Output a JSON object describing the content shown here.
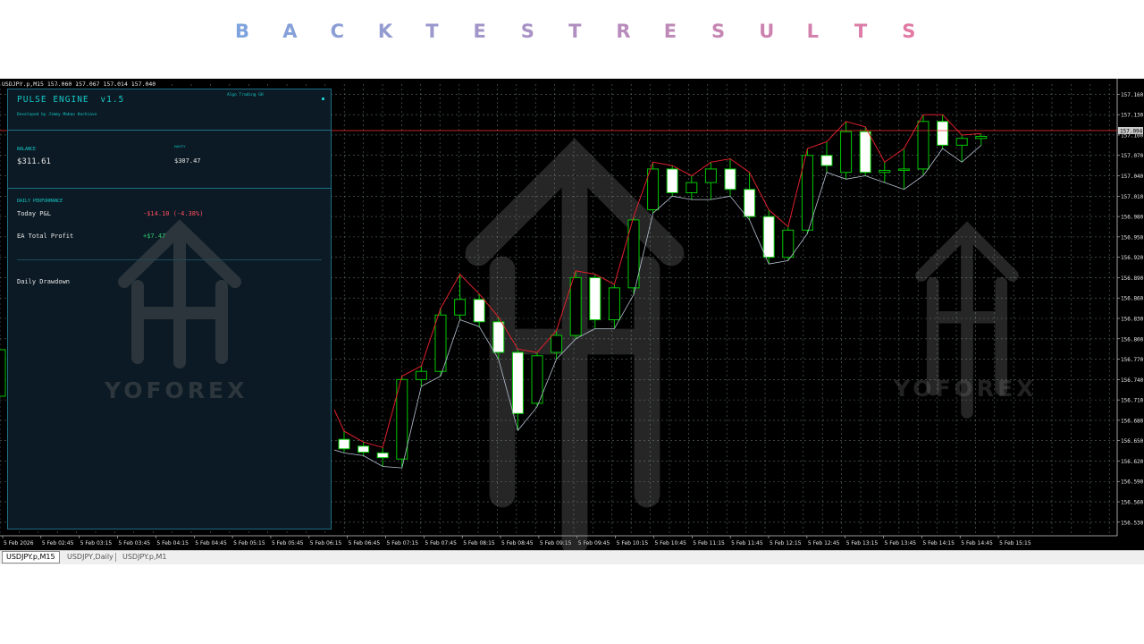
{
  "header": {
    "title": "BACKTEST RESULTS",
    "title_gradient": [
      "#7fa4dd",
      "#e27aa4"
    ]
  },
  "chart": {
    "symbol_info": "USDJPY.p,M15  157.060 157.067 157.014 157.040",
    "bid_price_label": "157.094",
    "watermark_text": "YOFOREX",
    "colors": {
      "background": "#000000",
      "grid": "#5c6b6b",
      "bull_body": "#000000",
      "bear_body": "#ffffff",
      "candle_outline": "#00c800",
      "upper_line": "#e0202c",
      "lower_line": "#b7c3d4",
      "bid_line": "#ff3030"
    }
  },
  "chart_data": {
    "type": "candlestick",
    "symbol": "USDJPY.p",
    "timeframe": "M15",
    "y_ticks": [
      "157.160",
      "157.130",
      "157.100",
      "157.070",
      "157.040",
      "157.010",
      "156.980",
      "156.950",
      "156.920",
      "156.890",
      "156.860",
      "156.830",
      "156.800",
      "156.770",
      "156.740",
      "156.710",
      "156.680",
      "156.650",
      "156.620",
      "156.590",
      "156.560",
      "156.530"
    ],
    "ylim": [
      156.51,
      157.175
    ],
    "x_ticks": [
      "5 Feb 2026",
      "5 Feb 02:45",
      "5 Feb 03:15",
      "5 Feb 03:45",
      "5 Feb 04:15",
      "5 Feb 04:45",
      "5 Feb 05:15",
      "5 Feb 05:45",
      "5 Feb 06:15",
      "5 Feb 06:45",
      "5 Feb 07:15",
      "5 Feb 07:45",
      "5 Feb 08:15",
      "5 Feb 08:45",
      "5 Feb 09:15",
      "5 Feb 09:45",
      "5 Feb 10:15",
      "5 Feb 10:45",
      "5 Feb 11:15",
      "5 Feb 11:45",
      "5 Feb 12:15",
      "5 Feb 12:45",
      "5 Feb 13:15",
      "5 Feb 13:45",
      "5 Feb 14:15",
      "5 Feb 14:45",
      "5 Feb 15:15"
    ],
    "candles": [
      {
        "o": 156.652,
        "h": 156.664,
        "l": 156.632,
        "c": 156.638
      },
      {
        "o": 156.642,
        "h": 156.648,
        "l": 156.628,
        "c": 156.633
      },
      {
        "o": 156.632,
        "h": 156.64,
        "l": 156.612,
        "c": 156.625
      },
      {
        "o": 156.623,
        "h": 156.745,
        "l": 156.61,
        "c": 156.74
      },
      {
        "o": 156.74,
        "h": 156.76,
        "l": 156.73,
        "c": 156.752
      },
      {
        "o": 156.752,
        "h": 156.845,
        "l": 156.745,
        "c": 156.835
      },
      {
        "o": 156.835,
        "h": 156.895,
        "l": 156.828,
        "c": 156.858
      },
      {
        "o": 156.858,
        "h": 156.866,
        "l": 156.818,
        "c": 156.825
      },
      {
        "o": 156.825,
        "h": 156.832,
        "l": 156.77,
        "c": 156.78
      },
      {
        "o": 156.78,
        "h": 156.785,
        "l": 156.665,
        "c": 156.69
      },
      {
        "o": 156.705,
        "h": 156.78,
        "l": 156.7,
        "c": 156.775
      },
      {
        "o": 156.78,
        "h": 156.812,
        "l": 156.77,
        "c": 156.805
      },
      {
        "o": 156.805,
        "h": 156.9,
        "l": 156.8,
        "c": 156.89
      },
      {
        "o": 156.89,
        "h": 156.895,
        "l": 156.815,
        "c": 156.828
      },
      {
        "o": 156.828,
        "h": 156.88,
        "l": 156.815,
        "c": 156.875
      },
      {
        "o": 156.875,
        "h": 156.98,
        "l": 156.865,
        "c": 156.975
      },
      {
        "o": 156.99,
        "h": 157.06,
        "l": 156.985,
        "c": 157.05
      },
      {
        "o": 157.05,
        "h": 157.055,
        "l": 157.01,
        "c": 157.015
      },
      {
        "o": 157.015,
        "h": 157.04,
        "l": 157.005,
        "c": 157.03
      },
      {
        "o": 157.03,
        "h": 157.06,
        "l": 157.005,
        "c": 157.05
      },
      {
        "o": 157.05,
        "h": 157.065,
        "l": 157.01,
        "c": 157.02
      },
      {
        "o": 157.02,
        "h": 157.045,
        "l": 156.975,
        "c": 156.98
      },
      {
        "o": 156.98,
        "h": 156.99,
        "l": 156.91,
        "c": 156.92
      },
      {
        "o": 156.92,
        "h": 156.965,
        "l": 156.915,
        "c": 156.96
      },
      {
        "o": 156.96,
        "h": 157.08,
        "l": 156.955,
        "c": 157.07
      },
      {
        "o": 157.07,
        "h": 157.09,
        "l": 157.045,
        "c": 157.055
      },
      {
        "o": 157.045,
        "h": 157.12,
        "l": 157.035,
        "c": 157.105
      },
      {
        "o": 157.105,
        "h": 157.112,
        "l": 157.04,
        "c": 157.045
      },
      {
        "o": 157.045,
        "h": 157.06,
        "l": 157.03,
        "c": 157.048
      },
      {
        "o": 157.048,
        "h": 157.08,
        "l": 157.02,
        "c": 157.05
      },
      {
        "o": 157.05,
        "h": 157.13,
        "l": 157.04,
        "c": 157.12
      },
      {
        "o": 157.12,
        "h": 157.13,
        "l": 157.08,
        "c": 157.085
      },
      {
        "o": 157.085,
        "h": 157.1,
        "l": 157.06,
        "c": 157.095
      },
      {
        "o": 157.095,
        "h": 157.102,
        "l": 157.085,
        "c": 157.098
      }
    ],
    "grid": true
  },
  "ea_panel": {
    "title": "PULSE ENGINE",
    "version": "v1.5",
    "developer": "Developed by Jimmy Mabao Kochiavo",
    "brand": "Algo Trading GH",
    "balance_label": "BALANCE",
    "balance_value": "$311.61",
    "equity_label": "EQUITY",
    "equity_value": "$307.47",
    "daily_section_label": "DAILY PERFORMANCE",
    "today_pnl_label": "Today P&L",
    "today_pnl_value": "-$14.10 (-4.38%)",
    "ea_profit_label": "EA Total Profit",
    "ea_profit_value": "+$7.47",
    "daily_drawdown_label": "Daily Drawdown",
    "colors": {
      "accent": "#16c8c8",
      "negative": "#ff4d5e",
      "positive": "#2ecc71"
    }
  },
  "tabs": [
    {
      "label": "USDJPY.p,M15",
      "active": true
    },
    {
      "label": "USDJPY,Daily",
      "active": false
    },
    {
      "label": "USDJPY.p,M1",
      "active": false
    }
  ]
}
